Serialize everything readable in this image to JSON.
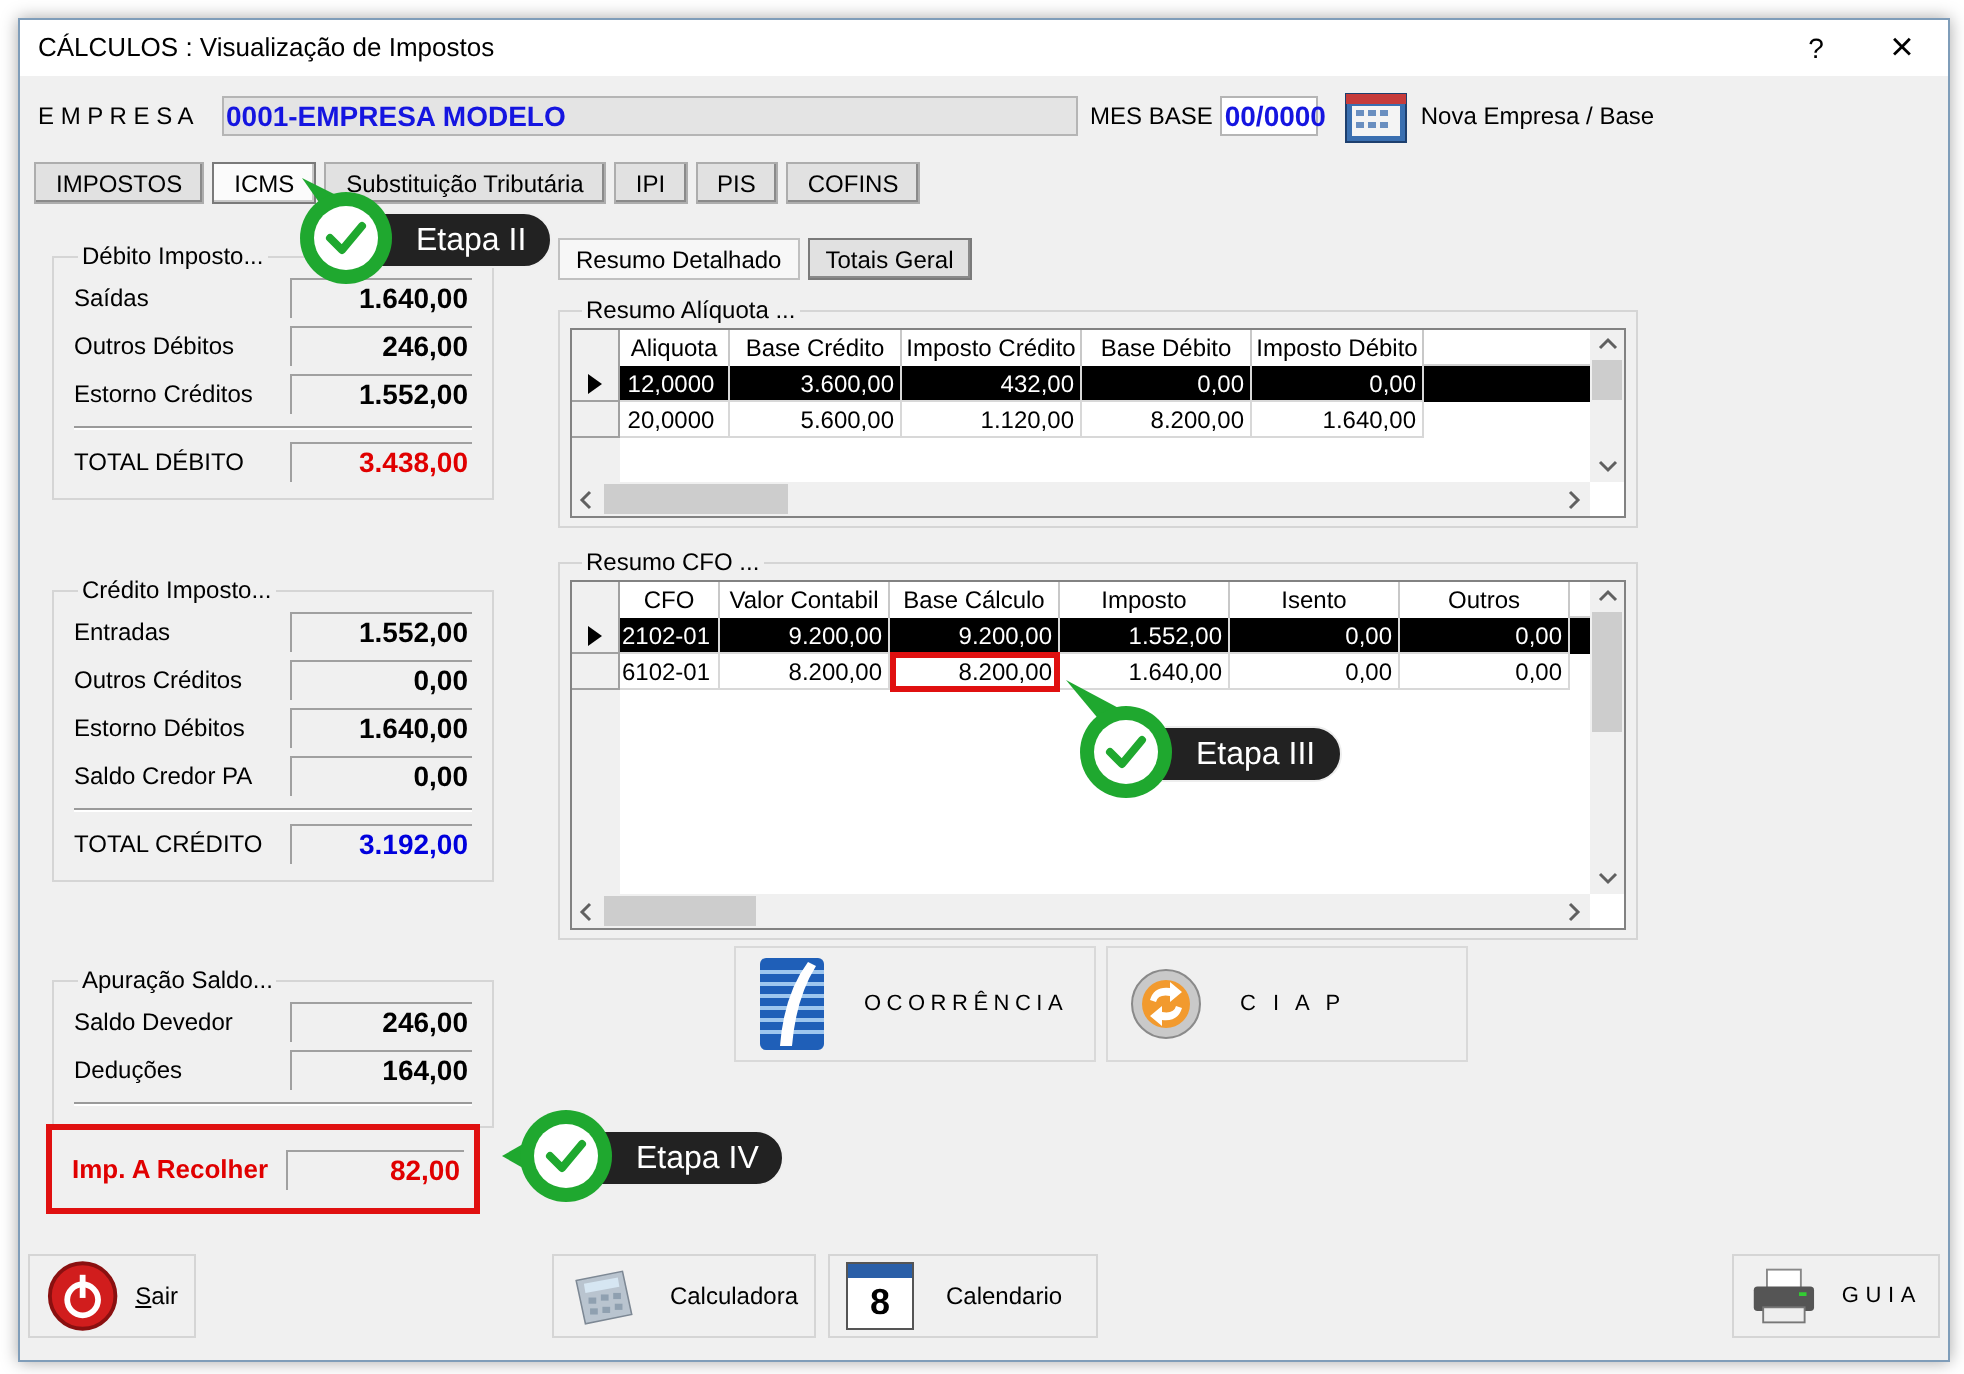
{
  "window": {
    "title": "CÁLCULOS : Visualização de Impostos",
    "help": "?",
    "close": "×"
  },
  "company": {
    "label": "E M P R E S A",
    "value": "0001-EMPRESA MODELO",
    "period_label": "MES BASE",
    "period_value": "00/0000",
    "new_button": "Nova Empresa / Base"
  },
  "tabs": [
    {
      "label": "IMPOSTOS",
      "selected": false
    },
    {
      "label": "ICMS",
      "selected": true
    },
    {
      "label": "Substituição Tributária",
      "selected": false
    },
    {
      "label": "IPI",
      "selected": false
    },
    {
      "label": "PIS",
      "selected": false
    },
    {
      "label": "COFINS",
      "selected": false
    }
  ],
  "debit": {
    "title": "Débito Imposto...",
    "rows": [
      {
        "label": "Saídas",
        "value": "1.640,00"
      },
      {
        "label": "Outros Débitos",
        "value": "246,00"
      },
      {
        "label": "Estorno Créditos",
        "value": "1.552,00"
      }
    ],
    "total": {
      "label": "TOTAL DÉBITO",
      "value": "3.438,00",
      "color": "#e00000"
    }
  },
  "credit": {
    "title": "Crédito Imposto...",
    "rows": [
      {
        "label": "Entradas",
        "value": "1.552,00"
      },
      {
        "label": "Outros Créditos",
        "value": "0,00"
      },
      {
        "label": "Estorno Débitos",
        "value": "1.640,00"
      },
      {
        "label": "Saldo Credor PA",
        "value": "0,00"
      }
    ],
    "total": {
      "label": "TOTAL CRÉDITO",
      "value": "3.192,00",
      "color": "#0000dd"
    }
  },
  "balance": {
    "title": "Apuração Saldo...",
    "rows": [
      {
        "label": "Saldo Devedor",
        "value": "246,00"
      },
      {
        "label": "Deduções",
        "value": "164,00"
      }
    ],
    "result": {
      "label": "Imp. A Recolher",
      "value": "82,00",
      "outlined": true
    }
  },
  "subtabs": [
    {
      "label": "Resumo Detalhado",
      "selected": true
    },
    {
      "label": "Totais Geral",
      "selected": false
    }
  ],
  "rate_summary": {
    "title": "Resumo Alíquota ...",
    "columns": [
      "Aliquota",
      "Base Crédito",
      "Imposto Crédito",
      "Base Débito",
      "Imposto Débito"
    ],
    "rows": [
      {
        "selected": true,
        "cells": [
          {
            "text": "12,0000",
            "outlined": false
          },
          {
            "text": "3.600,00",
            "outlined": false
          },
          {
            "text": "432,00",
            "outlined": false
          },
          {
            "text": "0,00",
            "outlined": false
          },
          {
            "text": "0,00",
            "outlined": false
          }
        ]
      },
      {
        "selected": false,
        "cells": [
          {
            "text": "20,0000",
            "outlined": false
          },
          {
            "text": "5.600,00",
            "outlined": false
          },
          {
            "text": "1.120,00",
            "outlined": false
          },
          {
            "text": "8.200,00",
            "outlined": false
          },
          {
            "text": "1.640,00",
            "outlined": false
          }
        ]
      }
    ]
  },
  "cfo_summary": {
    "title": "Resumo CFO ...",
    "columns": [
      "CFO",
      "Valor Contabil",
      "Base Cálculo",
      "Imposto",
      "Isento",
      "Outros"
    ],
    "rows": [
      {
        "selected": true,
        "cells": [
          {
            "text": "2102-01",
            "outlined": false
          },
          {
            "text": "9.200,00",
            "outlined": false
          },
          {
            "text": "9.200,00",
            "outlined": false
          },
          {
            "text": "1.552,00",
            "outlined": false
          },
          {
            "text": "0,00",
            "outlined": false
          },
          {
            "text": "0,00",
            "outlined": false
          }
        ]
      },
      {
        "selected": false,
        "cells": [
          {
            "text": "6102-01",
            "outlined": false
          },
          {
            "text": "8.200,00",
            "outlined": false
          },
          {
            "text": "8.200,00",
            "outlined": true
          },
          {
            "text": "1.640,00",
            "outlined": false
          },
          {
            "text": "0,00",
            "outlined": false
          },
          {
            "text": "0,00",
            "outlined": false
          }
        ]
      }
    ]
  },
  "actions": [
    {
      "label": "OCORRÊNCIA",
      "kind": "ocorrencia"
    },
    {
      "label": "C I A P",
      "kind": "ciap"
    }
  ],
  "footer_buttons": [
    {
      "label": "Sair",
      "kind": "exit"
    },
    {
      "label": "Calculadora",
      "kind": "calculator"
    },
    {
      "label": "Calendario",
      "kind": "calendar",
      "icon_text": "8"
    },
    {
      "label": "GUIA",
      "kind": "print"
    }
  ],
  "callouts": [
    {
      "label": "Etapa II",
      "kind": "tab"
    },
    {
      "label": "Etapa III",
      "kind": "cell"
    },
    {
      "label": "Etapa IV",
      "kind": "panel"
    }
  ]
}
